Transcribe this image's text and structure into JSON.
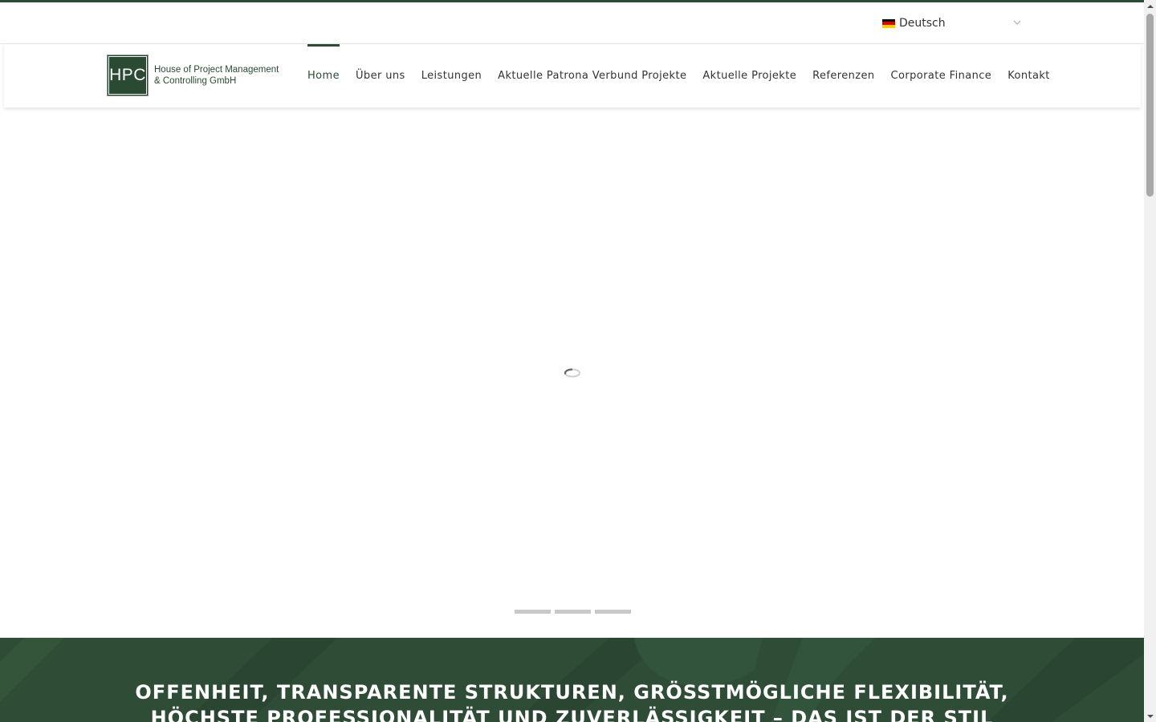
{
  "language_selector": {
    "flag_icon": "germany-flag-icon",
    "selected": "Deutsch",
    "dropdown_icon": "chevron-down-icon"
  },
  "logo": {
    "initials": "HPC",
    "line1": "House of Project Management",
    "line2": "& Controlling GmbH",
    "brand_color": "#2b4a34"
  },
  "nav": {
    "items": [
      {
        "label": "Home",
        "active": true
      },
      {
        "label": "Über uns",
        "active": false
      },
      {
        "label": "Leistungen",
        "active": false
      },
      {
        "label": "Aktuelle Patrona Verbund Projekte",
        "active": false
      },
      {
        "label": "Aktuelle Projekte",
        "active": false
      },
      {
        "label": "Referenzen",
        "active": false
      },
      {
        "label": "Corporate Finance",
        "active": false
      },
      {
        "label": "Kontakt",
        "active": false
      }
    ],
    "accent_color": "#2d4b35"
  },
  "hero": {
    "loading_icon": "loading-spinner-icon",
    "slides": 3
  },
  "band": {
    "tagline": "OFFENHEIT, TRANSPARENTE STRUKTUREN, GRÖSSTMÖGLICHE FLEXIBILITÄT, HÖCHSTE PROFESSIONALITÄT UND ZUVERLÄSSIGKEIT – DAS IST DER STIL UNSERES HAUSES.",
    "background_color": "#2e4c36"
  }
}
